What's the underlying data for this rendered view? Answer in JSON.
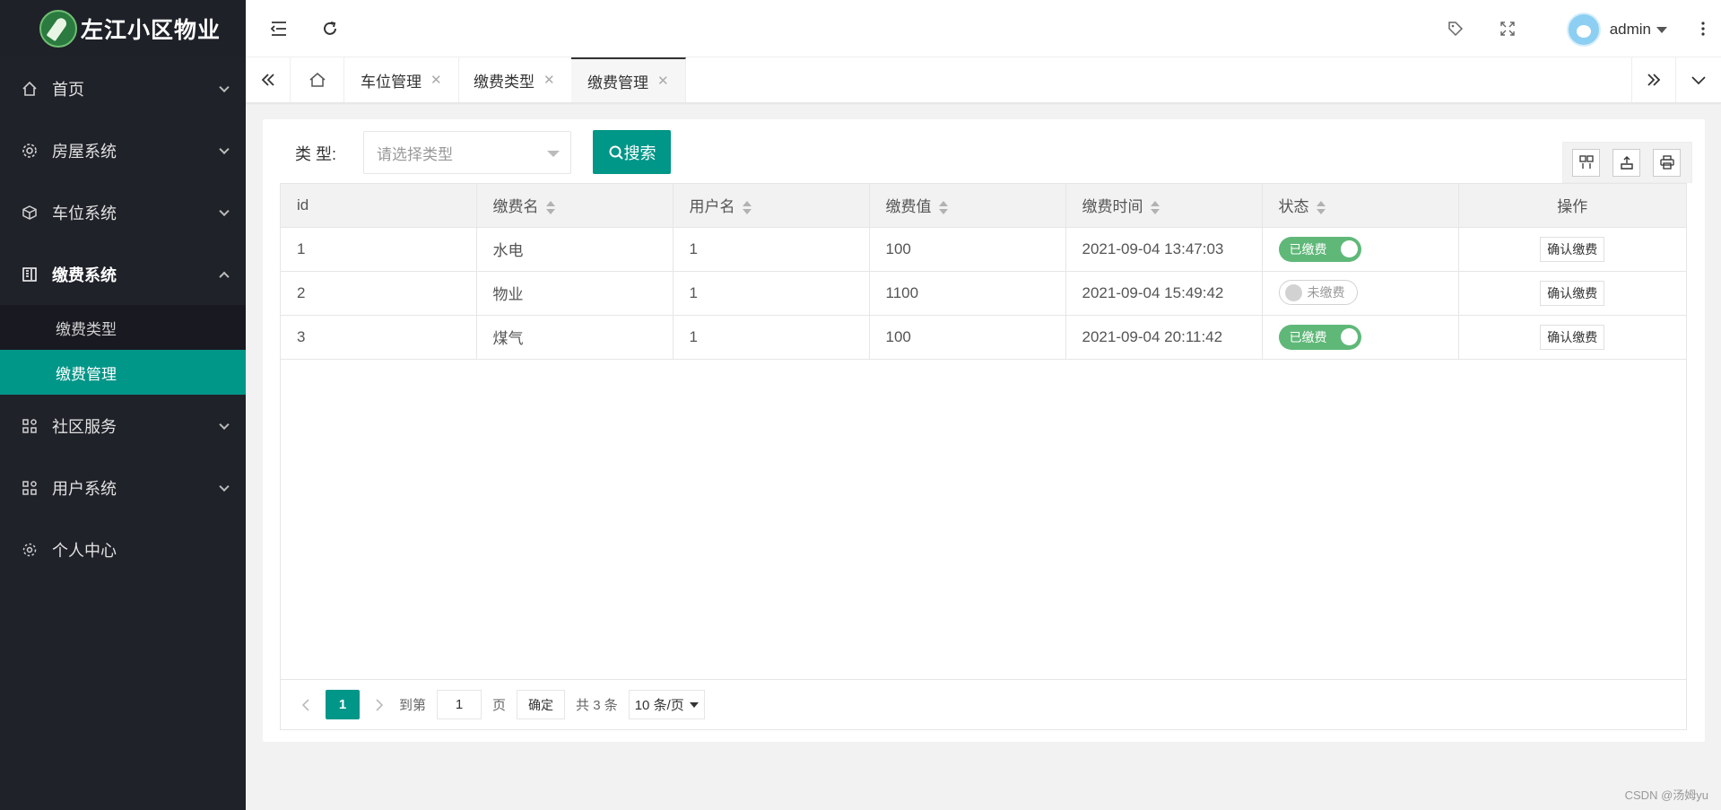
{
  "app": {
    "logo_text": "左江小区物业"
  },
  "sidebar": {
    "items": [
      {
        "label": "首页",
        "icon": "home-icon",
        "expanded": false
      },
      {
        "label": "房屋系统",
        "icon": "gear-icon",
        "expanded": false
      },
      {
        "label": "车位系统",
        "icon": "cube-icon",
        "expanded": false
      },
      {
        "label": "缴费系统",
        "icon": "book-icon",
        "expanded": true,
        "children": [
          {
            "label": "缴费类型",
            "active": false
          },
          {
            "label": "缴费管理",
            "active": true
          }
        ]
      },
      {
        "label": "社区服务",
        "icon": "apps-icon",
        "expanded": false
      },
      {
        "label": "用户系统",
        "icon": "apps-icon",
        "expanded": false
      },
      {
        "label": "个人中心",
        "icon": "settings-icon",
        "expanded": false
      }
    ]
  },
  "header": {
    "username": "admin"
  },
  "tabs": [
    {
      "label": "车位管理"
    },
    {
      "label": "缴费类型"
    },
    {
      "label": "缴费管理",
      "active": true
    }
  ],
  "search": {
    "label": "类 型:",
    "placeholder": "请选择类型",
    "button": "搜索"
  },
  "table": {
    "columns": [
      "id",
      "缴费名",
      "用户名",
      "缴费值",
      "缴费时间",
      "状态",
      "操作"
    ],
    "rows": [
      {
        "id": "1",
        "name": "水电",
        "user": "1",
        "value": "100",
        "time": "2021-09-04 13:47:03",
        "status": "已缴费",
        "paid": true,
        "action": "确认缴费"
      },
      {
        "id": "2",
        "name": "物业",
        "user": "1",
        "value": "1100",
        "time": "2021-09-04 15:49:42",
        "status": "未缴费",
        "paid": false,
        "action": "确认缴费"
      },
      {
        "id": "3",
        "name": "煤气",
        "user": "1",
        "value": "100",
        "time": "2021-09-04 20:11:42",
        "status": "已缴费",
        "paid": true,
        "action": "确认缴费"
      }
    ]
  },
  "pager": {
    "current": "1",
    "goto_label": "到第",
    "goto_value": "1",
    "page_label": "页",
    "confirm": "确定",
    "total": "共 3 条",
    "page_size": "10 条/页"
  },
  "colors": {
    "primary": "#009688",
    "sidebar": "#20222a",
    "switch_on": "#5fb878"
  },
  "watermark": "CSDN @汤姆yu"
}
